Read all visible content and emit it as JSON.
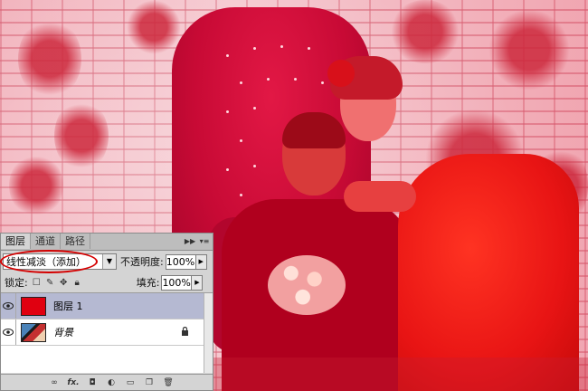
{
  "panel": {
    "tabs": [
      {
        "label": "图层",
        "active": true
      },
      {
        "label": "通道",
        "active": false
      },
      {
        "label": "路径",
        "active": false
      }
    ],
    "tab_menu_icons": [
      "collapse-icon",
      "panel-menu-icon"
    ],
    "blend_mode": "线性减淡（添加）",
    "opacity_label": "不透明度:",
    "opacity_value": "100%",
    "lock_label": "锁定:",
    "fill_label": "填充:",
    "fill_value": "100%",
    "layers": [
      {
        "name": "图层 1",
        "selected": true,
        "visible": true,
        "thumb": "solid-red"
      },
      {
        "name": "背景",
        "selected": false,
        "visible": true,
        "locked": true,
        "thumb": "photo"
      }
    ],
    "bottom_icons": [
      "link-layers-icon",
      "fx-icon",
      "add-mask-icon",
      "adjustment-layer-icon",
      "new-group-icon",
      "new-layer-icon",
      "trash-icon"
    ],
    "fx_text": "fx."
  },
  "colors": {
    "highlight_circle": "#d40000",
    "layer1_fill": "#e00010",
    "selected_row": "#b5b9d2"
  }
}
